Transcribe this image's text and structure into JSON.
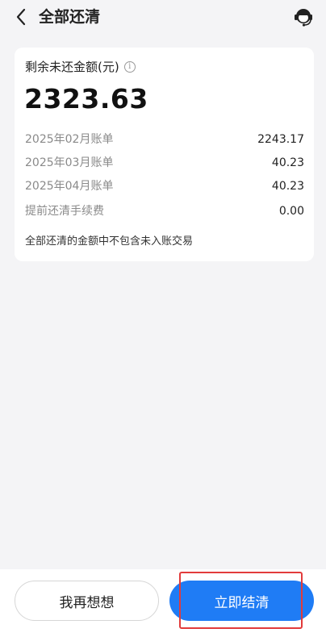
{
  "header": {
    "title": "全部还清",
    "back_icon": "chevron-left-icon",
    "service_icon": "customer-service-icon"
  },
  "summary": {
    "label": "剩余未还金额(元)",
    "amount": "2323.63",
    "info_icon": "info-icon"
  },
  "bills": [
    {
      "name": "2025年02月账单",
      "value": "2243.17"
    },
    {
      "name": "2025年03月账单",
      "value": "40.23"
    },
    {
      "name": "2025年04月账单",
      "value": "40.23"
    },
    {
      "name": "提前还清手续费",
      "value": "0.00"
    }
  ],
  "note": "全部还清的金额中不包含未入账交易",
  "actions": {
    "think_label": "我再想想",
    "settle_label": "立即结清"
  },
  "colors": {
    "primary": "#1f7cf5",
    "highlight": "#e23b3b",
    "background": "#f4f4f6"
  }
}
